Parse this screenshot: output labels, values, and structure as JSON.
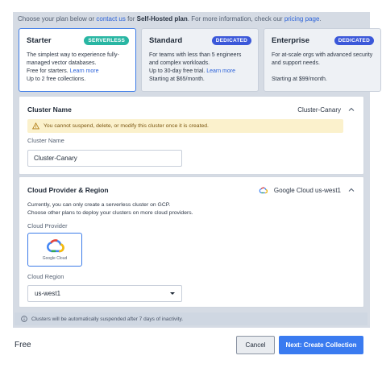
{
  "intro": {
    "prefix": "Choose your plan below or ",
    "contact_link": "contact us",
    "middle": " for ",
    "bold": "Self-Hosted plan",
    "suffix": ". For more information, check our ",
    "pricing_link": "pricing page",
    "end": "."
  },
  "plans": [
    {
      "name": "Starter",
      "badge": "SERVERLESS",
      "desc": "The simplest way to experience fully-managed vector databases.",
      "foot_line1": "Free for starters. ",
      "foot_link": "Learn more",
      "foot_line2": "Up to 2 free collections."
    },
    {
      "name": "Standard",
      "badge": "DEDICATED",
      "desc": "For teams with less than 5 engineers and complex workloads.",
      "foot_line1": "Up to 30-day free trial. ",
      "foot_link": "Learn more",
      "foot_line2": "Starting at $65/month."
    },
    {
      "name": "Enterprise",
      "badge": "DEDICATED",
      "desc": "For at-scale orgs with advanced security and support needs.",
      "foot_line1": "",
      "foot_link": "",
      "foot_line2": "Starting at $99/month."
    }
  ],
  "cluster": {
    "title": "Cluster Name",
    "current": "Cluster-Canary",
    "warning": "You cannot suspend, delete, or modify this cluster once it is created.",
    "field_label": "Cluster Name",
    "value": "Cluster-Canary"
  },
  "provider": {
    "title": "Cloud Provider & Region",
    "current": "Google Cloud us-west1",
    "note_line1": "Currently, you can only create a serverless cluster on GCP.",
    "note_line2": "Choose other plans to deploy your clusters on more cloud providers.",
    "provider_label": "Cloud Provider",
    "tile_label": "Google Cloud",
    "region_label": "Cloud Region",
    "region_value": "us-west1"
  },
  "info": "Clusters will be automatically suspended after 7 days of inactivity.",
  "footer": {
    "plan": "Free",
    "cancel": "Cancel",
    "next": "Next: Create Collection"
  },
  "colors": {
    "accent": "#3a7bf0",
    "serverless_badge": "#29b6a3",
    "dedicated_badge": "#3b58d9",
    "warning_bg": "#fbf1cc"
  }
}
